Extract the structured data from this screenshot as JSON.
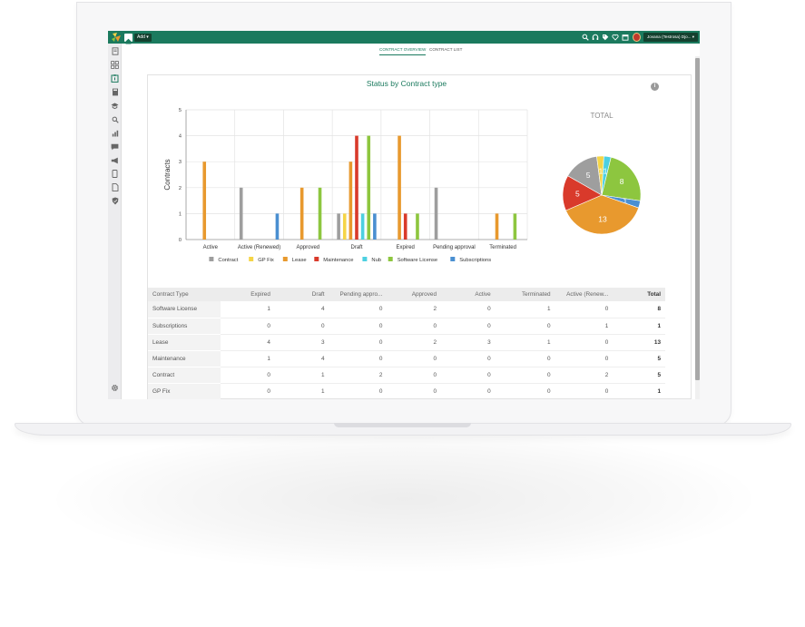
{
  "topbar": {
    "add_label": "Add ▾",
    "user_label": "Jovana (Testrosa) Djo... ▾",
    "icons": [
      "search-icon",
      "headset-icon",
      "tag-icon",
      "heart-icon",
      "calendar-icon"
    ]
  },
  "sidebar": {
    "icons": [
      "document-icon",
      "dashboard-icon",
      "contract-icon",
      "calculator-icon",
      "education-icon",
      "search-icon",
      "bar-chart-icon",
      "chat-icon",
      "megaphone-icon",
      "mobile-icon",
      "file-icon",
      "shield-icon"
    ],
    "settings_icon": "gear-icon"
  },
  "tabs": [
    {
      "label": "CONTRACT OVERVIEW",
      "active": true
    },
    {
      "label": "CONTRACT LIST",
      "active": false
    }
  ],
  "colors": {
    "brand": "#1b7a5e",
    "Contract": "#9e9e9e",
    "GP Fix": "#f5d547",
    "Lease": "#e8992e",
    "Maintenance": "#d93a2b",
    "Nub": "#4dd0e1",
    "Software License": "#8dc63f",
    "Subscriptions": "#4a8fd1"
  },
  "chart_data": [
    {
      "type": "bar",
      "title": "Status by Contract type",
      "xlabel": "",
      "ylabel": "Contracts",
      "ylim": [
        0,
        5
      ],
      "yticks": [
        "0",
        "1",
        "2",
        "3",
        "4",
        "5"
      ],
      "grid": true,
      "legend_position": "bottom",
      "categories": [
        "Active",
        "Active (Renewed)",
        "Approved",
        "Draft",
        "Expired",
        "Pending approval",
        "Terminated"
      ],
      "series": [
        {
          "name": "Contract",
          "values": [
            0,
            2,
            0,
            1,
            0,
            2,
            0
          ]
        },
        {
          "name": "GP Fix",
          "values": [
            0,
            0,
            0,
            1,
            0,
            0,
            0
          ]
        },
        {
          "name": "Lease",
          "values": [
            3,
            0,
            2,
            3,
            4,
            0,
            1
          ]
        },
        {
          "name": "Maintenance",
          "values": [
            0,
            0,
            0,
            4,
            1,
            0,
            0
          ]
        },
        {
          "name": "Nub",
          "values": [
            0,
            0,
            0,
            1,
            0,
            0,
            0
          ]
        },
        {
          "name": "Software License",
          "values": [
            0,
            0,
            2,
            4,
            1,
            0,
            1
          ]
        },
        {
          "name": "Subscriptions",
          "values": [
            0,
            1,
            0,
            1,
            0,
            0,
            0
          ]
        }
      ]
    },
    {
      "type": "pie",
      "title": "TOTAL",
      "slices": [
        {
          "name": "Software License",
          "value": 8
        },
        {
          "name": "Subscriptions",
          "value": 1
        },
        {
          "name": "Lease",
          "value": 13
        },
        {
          "name": "Maintenance",
          "value": 5
        },
        {
          "name": "Contract",
          "value": 5
        },
        {
          "name": "GP Fix",
          "value": 1
        },
        {
          "name": "Nub",
          "value": 1
        }
      ]
    }
  ],
  "table": {
    "headers": [
      "Contract Type",
      "Expired",
      "Draft",
      "Pending appro...",
      "Approved",
      "Active",
      "Terminated",
      "Active (Renew...",
      "Total"
    ],
    "rows": [
      [
        "Software License",
        "1",
        "4",
        "0",
        "2",
        "0",
        "1",
        "0",
        "8"
      ],
      [
        "Subscriptions",
        "0",
        "0",
        "0",
        "0",
        "0",
        "0",
        "1",
        "1"
      ],
      [
        "Lease",
        "4",
        "3",
        "0",
        "2",
        "3",
        "1",
        "0",
        "13"
      ],
      [
        "Maintenance",
        "1",
        "4",
        "0",
        "0",
        "0",
        "0",
        "0",
        "5"
      ],
      [
        "Contract",
        "0",
        "1",
        "2",
        "0",
        "0",
        "0",
        "2",
        "5"
      ],
      [
        "GP Fix",
        "0",
        "1",
        "0",
        "0",
        "0",
        "0",
        "0",
        "1"
      ]
    ]
  }
}
